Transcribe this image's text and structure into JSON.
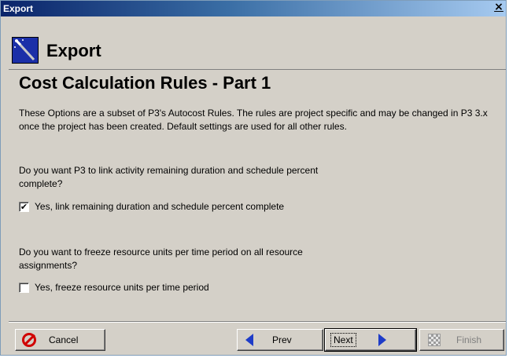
{
  "window": {
    "title": "Export",
    "close_glyph": "×"
  },
  "header": {
    "title": "Export",
    "icon": "wand-icon"
  },
  "page": {
    "title": "Cost Calculation Rules - Part 1",
    "intro": "These Options are a subset of P3's Autocost Rules.  The rules are project specific and may be changed in P3 3.x once the project has been created.  Default settings are used for all other rules."
  },
  "questions": [
    {
      "text": "Do you want P3 to link activity remaining duration and schedule percent complete?",
      "checkbox_label": "Yes, link remaining duration and schedule percent complete",
      "checked": true,
      "check_glyph": "✔"
    },
    {
      "text": "Do you want to freeze resource units per time period on all resource assignments?",
      "checkbox_label": "Yes, freeze resource units per time period",
      "checked": false,
      "check_glyph": ""
    }
  ],
  "buttons": {
    "cancel": "Cancel",
    "prev": "Prev",
    "next": "Next",
    "finish": "Finish"
  },
  "colors": {
    "title_bar": "#0a246a",
    "dialog": "#d4d0c8",
    "arrow": "#1e3cc8",
    "cancel_icon": "#d00000"
  }
}
